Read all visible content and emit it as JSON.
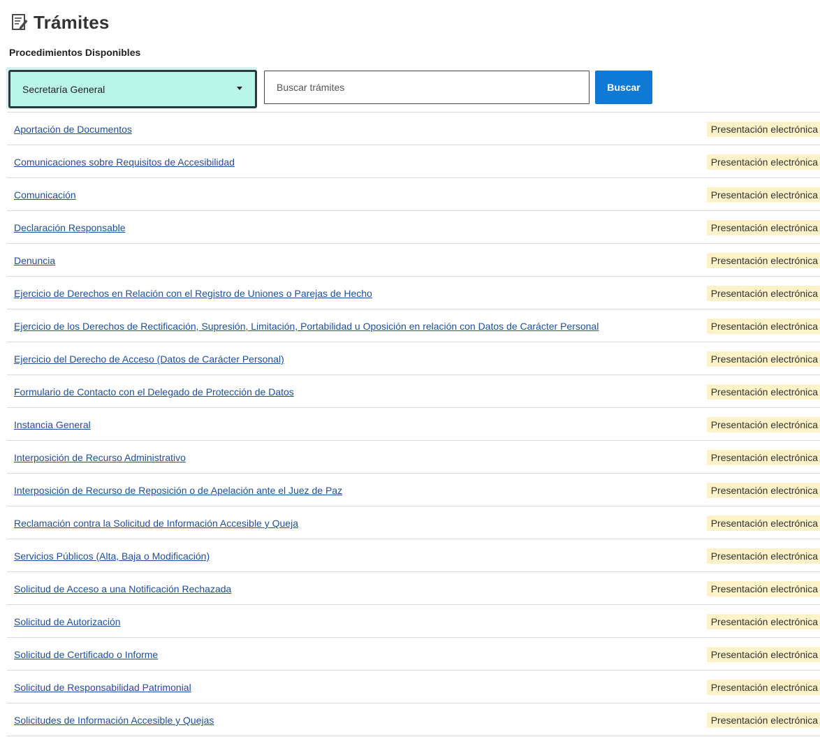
{
  "header": {
    "title": "Trámites",
    "title_icon": "edit-document-icon",
    "subtitle": "Procedimientos Disponibles"
  },
  "filters": {
    "department_selected": "Secretaría General",
    "search_placeholder": "Buscar trámites",
    "search_value": "",
    "search_button_label": "Buscar"
  },
  "colors": {
    "select_background": "#b9f5e9",
    "button_background": "#0f7ad6",
    "link": "#1d4f9c",
    "badge_background": "#fdf2c8"
  },
  "procedures": [
    {
      "name": "Aportación de Documentos",
      "badge": "Presentación electrónica"
    },
    {
      "name": "Comunicaciones sobre Requisitos de Accesibilidad",
      "badge": "Presentación electrónica"
    },
    {
      "name": "Comunicación",
      "badge": "Presentación electrónica"
    },
    {
      "name": "Declaración Responsable",
      "badge": "Presentación electrónica"
    },
    {
      "name": "Denuncia",
      "badge": "Presentación electrónica"
    },
    {
      "name": "Ejercicio de Derechos en Relación con el Registro de Uniones o Parejas de Hecho",
      "badge": "Presentación electrónica"
    },
    {
      "name": "Ejercicio de los Derechos de Rectificación, Supresión, Limitación, Portabilidad u Oposición en relación con Datos de Carácter Personal",
      "badge": "Presentación electrónica"
    },
    {
      "name": "Ejercicio del Derecho de Acceso (Datos de Carácter Personal)",
      "badge": "Presentación electrónica"
    },
    {
      "name": "Formulario de Contacto con el Delegado de Protección de Datos",
      "badge": "Presentación electrónica"
    },
    {
      "name": "Instancia General",
      "badge": "Presentación electrónica"
    },
    {
      "name": "Interposición de Recurso Administrativo",
      "badge": "Presentación electrónica"
    },
    {
      "name": "Interposición de Recurso de Reposición o de Apelación ante el Juez de Paz",
      "badge": "Presentación electrónica"
    },
    {
      "name": "Reclamación contra la Solicitud de Información Accesible y Queja",
      "badge": "Presentación electrónica"
    },
    {
      "name": "Servicios Públicos (Alta, Baja o Modificación)",
      "badge": "Presentación electrónica"
    },
    {
      "name": "Solicitud de Acceso a una Notificación Rechazada",
      "badge": "Presentación electrónica"
    },
    {
      "name": "Solicitud de Autorización",
      "badge": "Presentación electrónica"
    },
    {
      "name": "Solicitud de Certificado o Informe",
      "badge": "Presentación electrónica"
    },
    {
      "name": "Solicitud de Responsabilidad Patrimonial",
      "badge": "Presentación electrónica"
    },
    {
      "name": "Solicitudes de Información Accesible y Quejas",
      "badge": "Presentación electrónica"
    }
  ]
}
